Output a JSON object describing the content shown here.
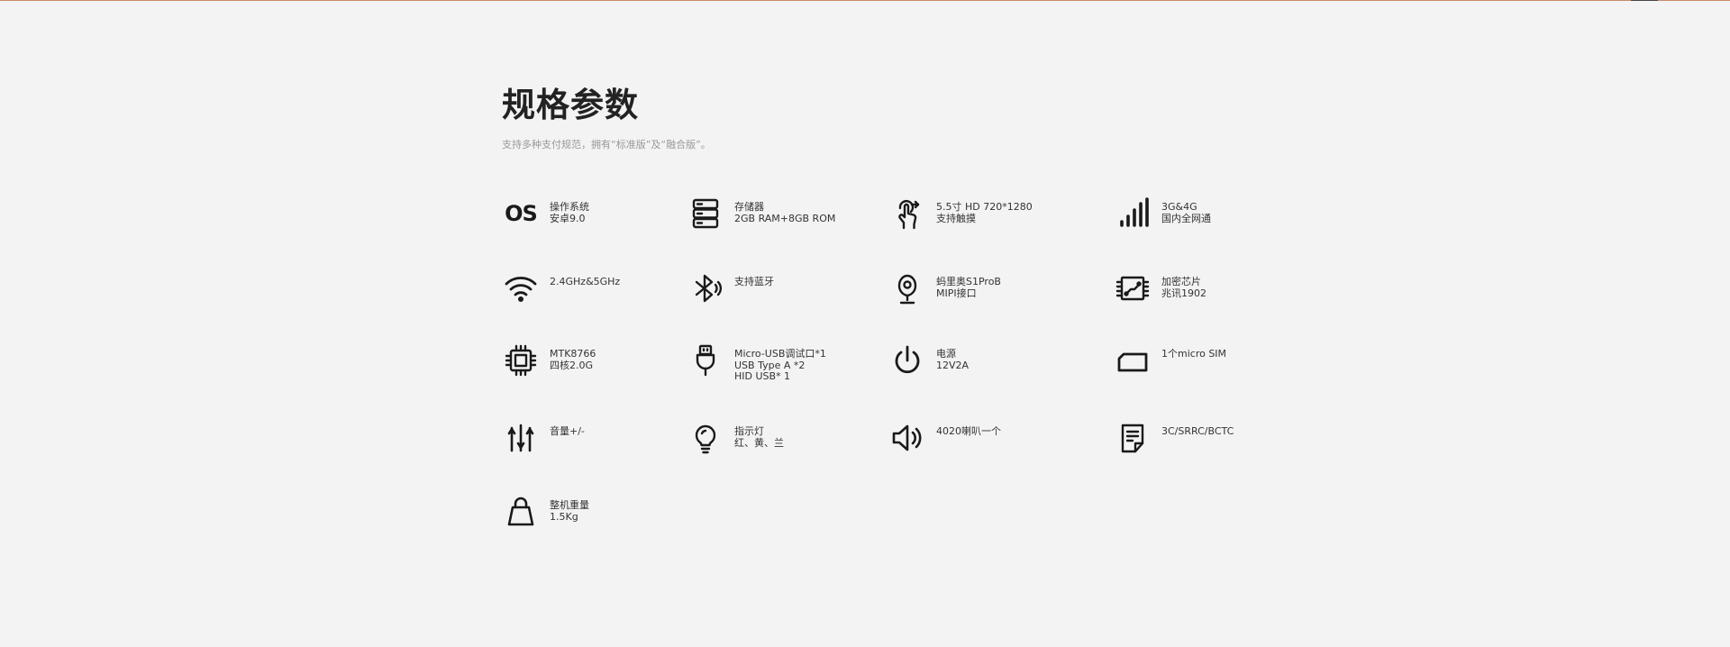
{
  "section": {
    "title": "规格参数",
    "subtitle": "支持多种支付规范，拥有“标准版”及“融合版”。"
  },
  "icon_os_text": "OS",
  "specs": [
    {
      "icon": "os-icon",
      "lines": [
        "操作系统",
        "安卓9.0"
      ]
    },
    {
      "icon": "storage-icon",
      "lines": [
        "存储器",
        "2GB RAM+8GB ROM"
      ]
    },
    {
      "icon": "touch-screen-icon",
      "lines": [
        "5.5寸 HD 720*1280",
        "支持触摸"
      ]
    },
    {
      "icon": "signal-bars-icon",
      "lines": [
        "3G&4G",
        "国内全网通"
      ]
    },
    {
      "icon": "wifi-icon",
      "lines": [
        "2.4GHz&5GHz"
      ]
    },
    {
      "icon": "bluetooth-icon",
      "lines": [
        "支持蓝牙"
      ]
    },
    {
      "icon": "camera-icon",
      "lines": [
        "蚂里奥S1ProB",
        "MIPI接口"
      ]
    },
    {
      "icon": "encryption-chip-icon",
      "lines": [
        "加密芯片",
        "兆讯1902"
      ]
    },
    {
      "icon": "cpu-chip-icon",
      "lines": [
        "MTK8766",
        "四核2.0G"
      ]
    },
    {
      "icon": "usb-plug-icon",
      "lines": [
        "Micro-USB调试口*1",
        "USB Type A *2",
        "HID USB* 1"
      ]
    },
    {
      "icon": "power-icon",
      "lines": [
        "电源",
        "12V2A"
      ]
    },
    {
      "icon": "sim-card-icon",
      "lines": [
        "1个micro SIM"
      ]
    },
    {
      "icon": "volume-sliders-icon",
      "lines": [
        "音量+/-"
      ]
    },
    {
      "icon": "light-bulb-icon",
      "lines": [
        "指示灯",
        "红、黄、兰"
      ]
    },
    {
      "icon": "speaker-icon",
      "lines": [
        "4020喇叭一个"
      ]
    },
    {
      "icon": "certificate-document-icon",
      "lines": [
        "3C/SRRC/BCTC"
      ]
    },
    {
      "icon": "weight-icon",
      "lines": [
        "整机重量",
        "1.5Kg"
      ]
    }
  ]
}
